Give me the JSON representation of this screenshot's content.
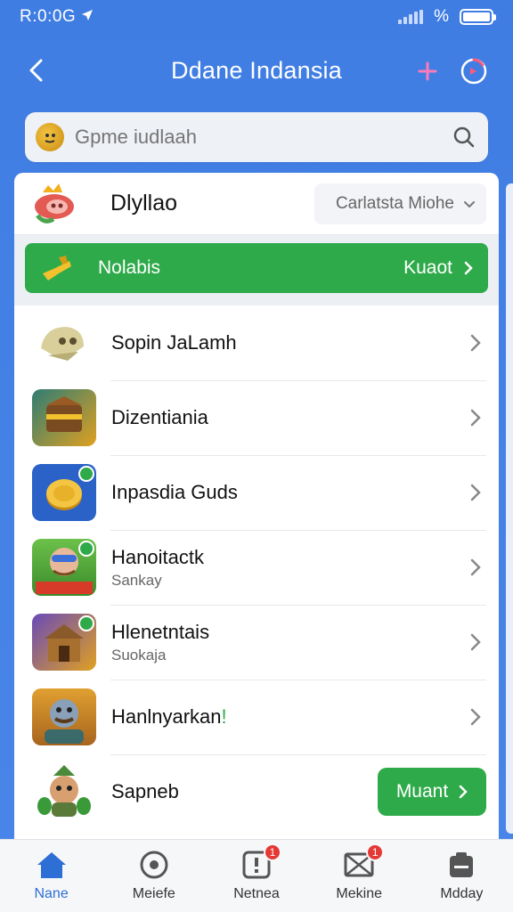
{
  "status_bar": {
    "time": "R:0:0G",
    "network": "%"
  },
  "header": {
    "title": "Ddane Indansia"
  },
  "search": {
    "placeholder": "Gpme iudlaah",
    "value": ""
  },
  "card_header": {
    "title": "Dlyllao",
    "dropdown": "Carlatsta Miohe"
  },
  "banner": {
    "label": "Nolabis",
    "action": "Kuaot"
  },
  "list": [
    {
      "title": "Sopin JaLamh",
      "subtitle": ""
    },
    {
      "title": "Dizentiania",
      "subtitle": ""
    },
    {
      "title": "Inpasdia Guds",
      "subtitle": ""
    },
    {
      "title": "Hanoitactk",
      "subtitle": "Sankay"
    },
    {
      "title": "Hlenetntais",
      "subtitle": "Suokaja"
    },
    {
      "title": "Hanlnyarkan",
      "subtitle": "",
      "suffix": "!"
    },
    {
      "title": "Sapneb",
      "subtitle": "",
      "button": "Muant"
    }
  ],
  "bottom_nav": [
    {
      "label": "Nane",
      "active": true,
      "badge": ""
    },
    {
      "label": "Meiefe",
      "active": false,
      "badge": ""
    },
    {
      "label": "Netnea",
      "active": false,
      "badge": "1"
    },
    {
      "label": "Mekine",
      "active": false,
      "badge": "1"
    },
    {
      "label": "Mdday",
      "active": false,
      "badge": ""
    }
  ],
  "colors": {
    "primary": "#4a86e8",
    "green": "#2faa4a",
    "badge": "#e53935"
  }
}
